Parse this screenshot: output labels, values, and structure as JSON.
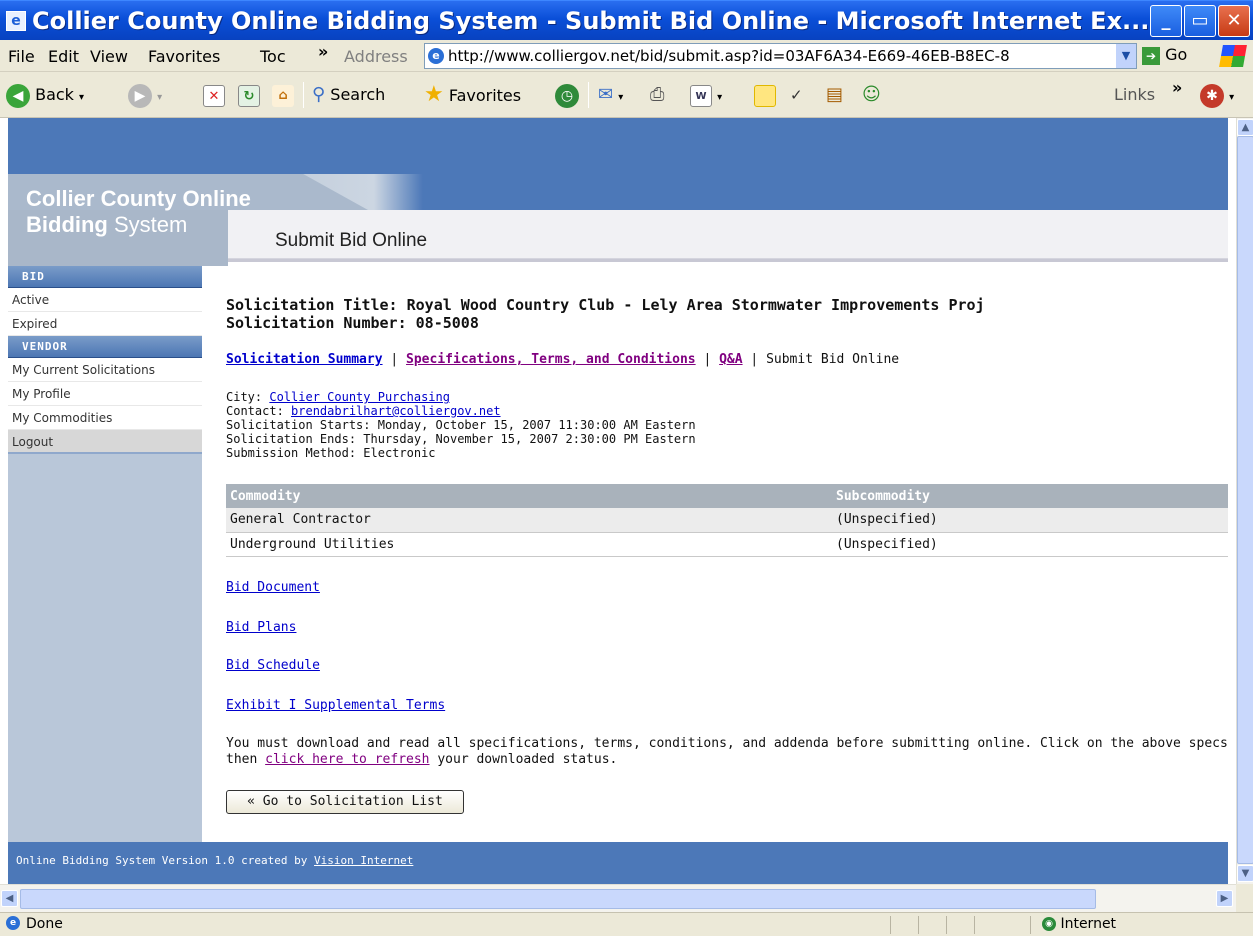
{
  "window": {
    "title": "Collier County Online Bidding System - Submit Bid Online - Microsoft Internet Ex...",
    "minimize": "_",
    "maximize": "▭",
    "close": "✕"
  },
  "menubar": {
    "items": [
      "File",
      "Edit",
      "View",
      "Favorites",
      "Toc"
    ],
    "overflow": "»",
    "address_label": "Address",
    "address_value": "http://www.colliergov.net/bid/submit.asp?id=03AF6A34-E669-46EB-B8EC-8",
    "go_label": "Go"
  },
  "toolbar": {
    "back_label": "Back",
    "search_label": "Search",
    "favorites_label": "Favorites",
    "links_label": "Links",
    "overflow": "»"
  },
  "site": {
    "logo_line1": "Collier County Online",
    "logo_line2_bold": "Bidding",
    "logo_line2_rest": " System",
    "page_subtitle": "Submit Bid Online"
  },
  "sidebar": {
    "bid_header": "BID",
    "bid_items": [
      "Active",
      "Expired"
    ],
    "vendor_header": "VENDOR",
    "vendor_items": [
      "My Current Solicitations",
      "My Profile",
      "My Commodities"
    ],
    "logout": "Logout"
  },
  "main": {
    "title": "Solicitation Title: Royal Wood Country Club - Lely Area Stormwater Improvements Proj",
    "number": "Solicitation Number: 08-5008",
    "nav": {
      "summary": "Solicitation Summary",
      "specs": "Specifications, Terms, and Conditions",
      "qa": "Q&A",
      "current": "Submit Bid Online",
      "sep": " | "
    },
    "meta": {
      "city_label": "City: ",
      "city_value": "Collier County Purchasing",
      "contact_label": "Contact: ",
      "contact_value": "brendabrilhart@colliergov.net",
      "starts": "Solicitation Starts: Monday, October 15, 2007 11:30:00 AM Eastern",
      "ends": "Solicitation Ends: Thursday, November 15, 2007 2:30:00 PM Eastern",
      "method": "Submission Method: Electronic"
    },
    "table": {
      "headers": [
        "Commodity",
        "Subcommodity"
      ],
      "rows": [
        [
          "General Contractor",
          "(Unspecified)"
        ],
        [
          "Underground Utilities",
          "(Unspecified)"
        ]
      ]
    },
    "documents": [
      "Bid Document",
      "Bid Plans",
      "Bid Schedule",
      "Exhibit I Supplemental Terms"
    ],
    "notice_line1": "You must download and read all specifications, terms, conditions, and addenda before submitting online. Click on the above specs or addenda t",
    "notice_prefix": "then ",
    "notice_link": "click here to refresh",
    "notice_suffix": " your downloaded status.",
    "back_button": "« Go to Solicitation List"
  },
  "footer": {
    "text": "Online Bidding System Version 1.0 created by ",
    "link": "Vision Internet"
  },
  "statusbar": {
    "status": "Done",
    "zone": "Internet"
  },
  "colors": {
    "brand_blue": "#4c78b8",
    "link": "#0000cc",
    "visited_link": "#800080"
  }
}
